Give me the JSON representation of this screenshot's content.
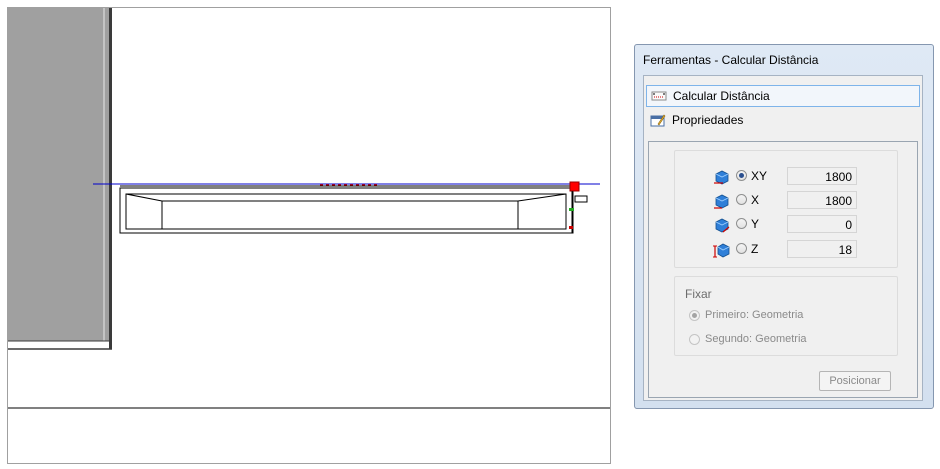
{
  "panel": {
    "title": "Ferramentas - Calcular Distância",
    "tabs": [
      {
        "label": "Calcular Distância",
        "icon": "ruler-distance-icon",
        "selected": true
      },
      {
        "label": "Propriedades",
        "icon": "properties-icon",
        "selected": false
      }
    ],
    "axes": [
      {
        "label": "XY",
        "value": "1800",
        "checked": true,
        "icon": "xy-axis-icon"
      },
      {
        "label": "X",
        "value": "1800",
        "checked": false,
        "icon": "x-axis-icon"
      },
      {
        "label": "Y",
        "value": "0",
        "checked": false,
        "icon": "y-axis-icon"
      },
      {
        "label": "Z",
        "value": "18",
        "checked": false,
        "icon": "z-axis-icon"
      }
    ],
    "fixar": {
      "legend": "Fixar",
      "options": [
        {
          "label": "Primeiro: Geometria",
          "checked": true
        },
        {
          "label": "Segundo: Geometria",
          "checked": false
        }
      ]
    },
    "posicionar_label": "Posicionar"
  },
  "colors": {
    "wall": "#a0a0a0",
    "measure_line": "#0000cc",
    "point_marker": "#ff0000"
  }
}
